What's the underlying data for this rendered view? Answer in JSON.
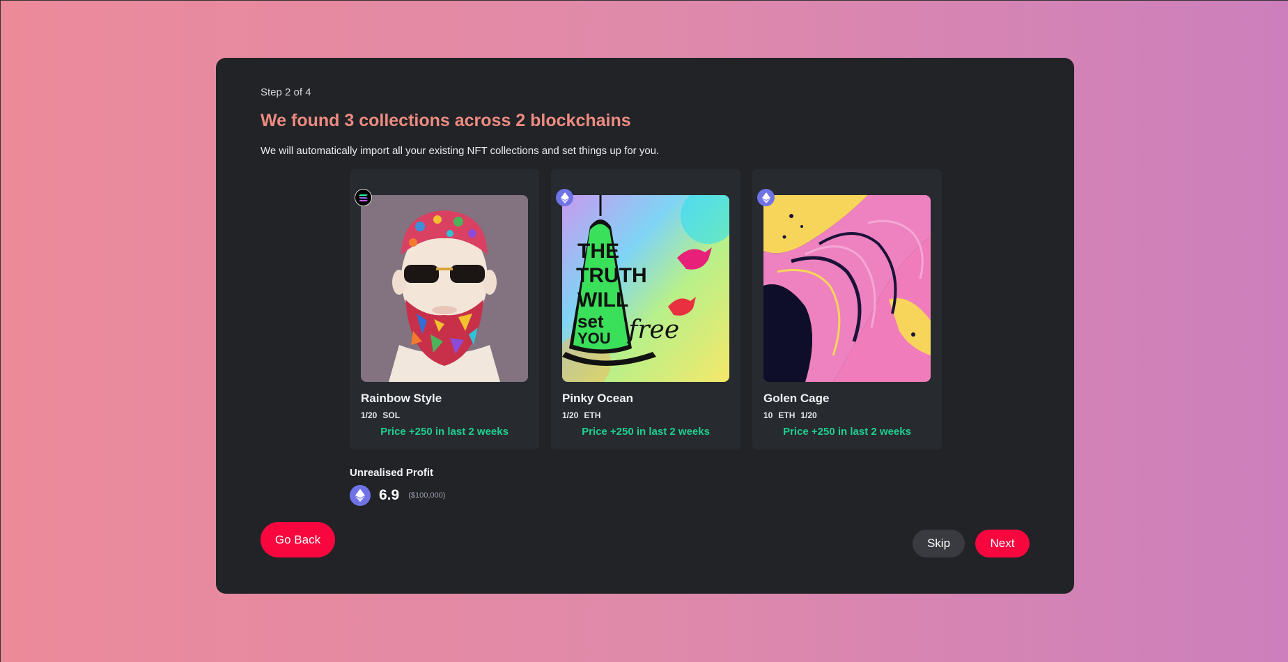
{
  "header": {
    "step": "Step 2 of 4",
    "title": "We found 3 collections across 2 blockchains",
    "subtitle": "We will automatically import all your existing NFT collections and set things up for you."
  },
  "collections": [
    {
      "name": "Rainbow Style",
      "meta": [
        "1/20",
        "SOL"
      ],
      "price": "Price +250 in last 2 weeks",
      "chain": "solana-icon"
    },
    {
      "name": "Pinky Ocean",
      "meta": [
        "1/20",
        "ETH"
      ],
      "price": "Price +250 in last 2 weeks",
      "chain": "ethereum-icon"
    },
    {
      "name": "Golen Cage",
      "meta": [
        "10",
        "ETH",
        "1/20"
      ],
      "price": "Price +250 in last 2 weeks",
      "chain": "ethereum-icon"
    }
  ],
  "profit": {
    "label": "Unrealised Profit",
    "value": "6.9",
    "usd": "($100,000)",
    "icon": "ethereum-icon"
  },
  "buttons": {
    "back": "Go Back",
    "skip": "Skip",
    "next": "Next"
  },
  "colors": {
    "accent": "#f8073f",
    "title": "#ee8b80",
    "price_up": "#1fcf8e",
    "eth": "#6f73e6"
  }
}
